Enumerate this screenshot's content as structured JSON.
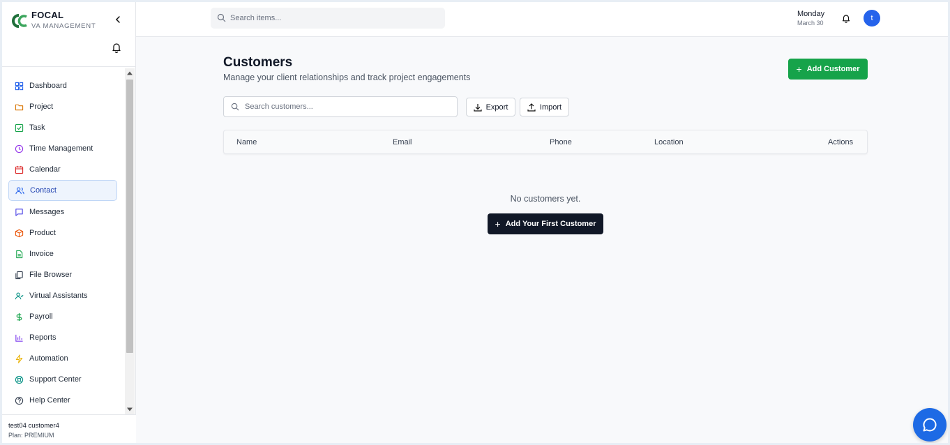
{
  "brand": {
    "name": "FOCAL",
    "subtitle": "VA MANAGEMENT"
  },
  "colors": {
    "accent_green": "#16a34a",
    "active_blue": "#1e40af",
    "avatar_blue": "#2563eb",
    "dark_button": "#111827"
  },
  "sidebar": {
    "items": [
      {
        "label": "Dashboard",
        "icon": "grid-icon",
        "active": false
      },
      {
        "label": "Project",
        "icon": "folder-icon",
        "active": false
      },
      {
        "label": "Task",
        "icon": "check-square-icon",
        "active": false
      },
      {
        "label": "Time Management",
        "icon": "clock-icon",
        "active": false
      },
      {
        "label": "Calendar",
        "icon": "calendar-icon",
        "active": false
      },
      {
        "label": "Contact",
        "icon": "users-icon",
        "active": true
      },
      {
        "label": "Messages",
        "icon": "message-icon",
        "active": false
      },
      {
        "label": "Product",
        "icon": "box-icon",
        "active": false
      },
      {
        "label": "Invoice",
        "icon": "file-text-icon",
        "active": false
      },
      {
        "label": "File Browser",
        "icon": "files-icon",
        "active": false
      },
      {
        "label": "Virtual Assistants",
        "icon": "user-check-icon",
        "active": false
      },
      {
        "label": "Payroll",
        "icon": "dollar-icon",
        "active": false
      },
      {
        "label": "Reports",
        "icon": "bar-chart-icon",
        "active": false
      },
      {
        "label": "Automation",
        "icon": "zap-icon",
        "active": false
      },
      {
        "label": "Support Center",
        "icon": "life-buoy-icon",
        "active": false
      },
      {
        "label": "Help Center",
        "icon": "help-circle-icon",
        "active": false
      }
    ],
    "user": {
      "name": "test04 customer4",
      "plan": "Plan: PREMIUM"
    }
  },
  "topbar": {
    "search_placeholder": "Search items...",
    "day": "Monday",
    "date": "March 30",
    "avatar_initial": "t"
  },
  "main": {
    "title": "Customers",
    "subtitle": "Manage your client relationships and track project engagements",
    "add_button": "Add Customer",
    "search_placeholder": "Search customers...",
    "export_label": "Export",
    "import_label": "Import",
    "columns": [
      "Name",
      "Email",
      "Phone",
      "Location",
      "Actions"
    ],
    "empty_message": "No customers yet.",
    "first_button": "Add Your First Customer"
  }
}
